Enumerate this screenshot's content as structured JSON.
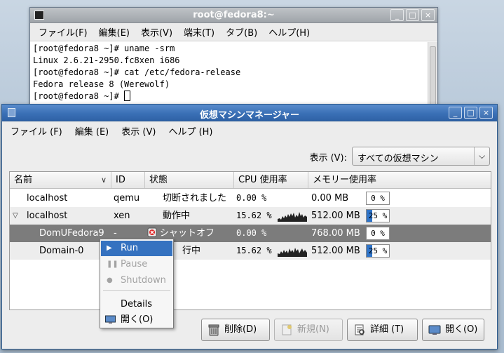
{
  "terminal": {
    "title": "root@fedora8:~",
    "menu": [
      "ファイル(F)",
      "編集(E)",
      "表示(V)",
      "端末(T)",
      "タブ(B)",
      "ヘルプ(H)"
    ],
    "lines": [
      "[root@fedora8 ~]# uname -srm",
      "Linux 2.6.21-2950.fc8xen i686",
      "[root@fedora8 ~]# cat /etc/fedora-release",
      "Fedora release 8 (Werewolf)",
      "[root@fedora8 ~]# "
    ],
    "window_buttons": [
      "_",
      "□",
      "×"
    ]
  },
  "vmm": {
    "title": "仮想マシンマネージャー",
    "menu": [
      "ファイル (F)",
      "編集 (E)",
      "表示 (V)",
      "ヘルプ (H)"
    ],
    "view_label": "表示 (V):",
    "view_selected": "すべての仮想マシン",
    "columns": {
      "name": "名前",
      "id": "ID",
      "state": "状態",
      "cpu": "CPU 使用率",
      "mem": "メモリー使用率"
    },
    "rows": [
      {
        "name": "localhost",
        "id": "qemu",
        "state": "切断されました",
        "cpu": "0.00 %",
        "mem": "0.00 MB",
        "mem_pct": "0 %",
        "mem_fraction": 0.0,
        "expander": ""
      },
      {
        "name": "localhost",
        "id": "xen",
        "state": "動作中",
        "cpu": "15.62 %",
        "mem": "512.00 MB",
        "mem_pct": "25 %",
        "mem_fraction": 0.25,
        "expander": "▽"
      },
      {
        "name": "DomUFedora9",
        "id": "-",
        "state": "シャットオフ",
        "cpu": "0.00 %",
        "mem": "768.00 MB",
        "mem_pct": "0 %",
        "mem_fraction": 0.0,
        "expander": ""
      },
      {
        "name": "Domain-0",
        "id": "",
        "state": "行中",
        "cpu": "15.62 %",
        "mem": "512.00 MB",
        "mem_pct": "25 %",
        "mem_fraction": 0.25,
        "expander": ""
      }
    ],
    "context_menu": {
      "run": "Run",
      "pause": "Pause",
      "shutdown": "Shutdown",
      "details": "Details",
      "open": "開く(O)"
    },
    "buttons": {
      "delete": "削除(D)",
      "new": "新規(N)",
      "details": "詳細 (T)",
      "open": "開く(O)"
    },
    "window_buttons": [
      "_",
      "□",
      "×"
    ]
  },
  "colors": {
    "selection": "#3572c0",
    "selected_row": "#7c7c7c",
    "titlebar_active": "#3a70b6",
    "mem_fill": "#2f74c9"
  }
}
